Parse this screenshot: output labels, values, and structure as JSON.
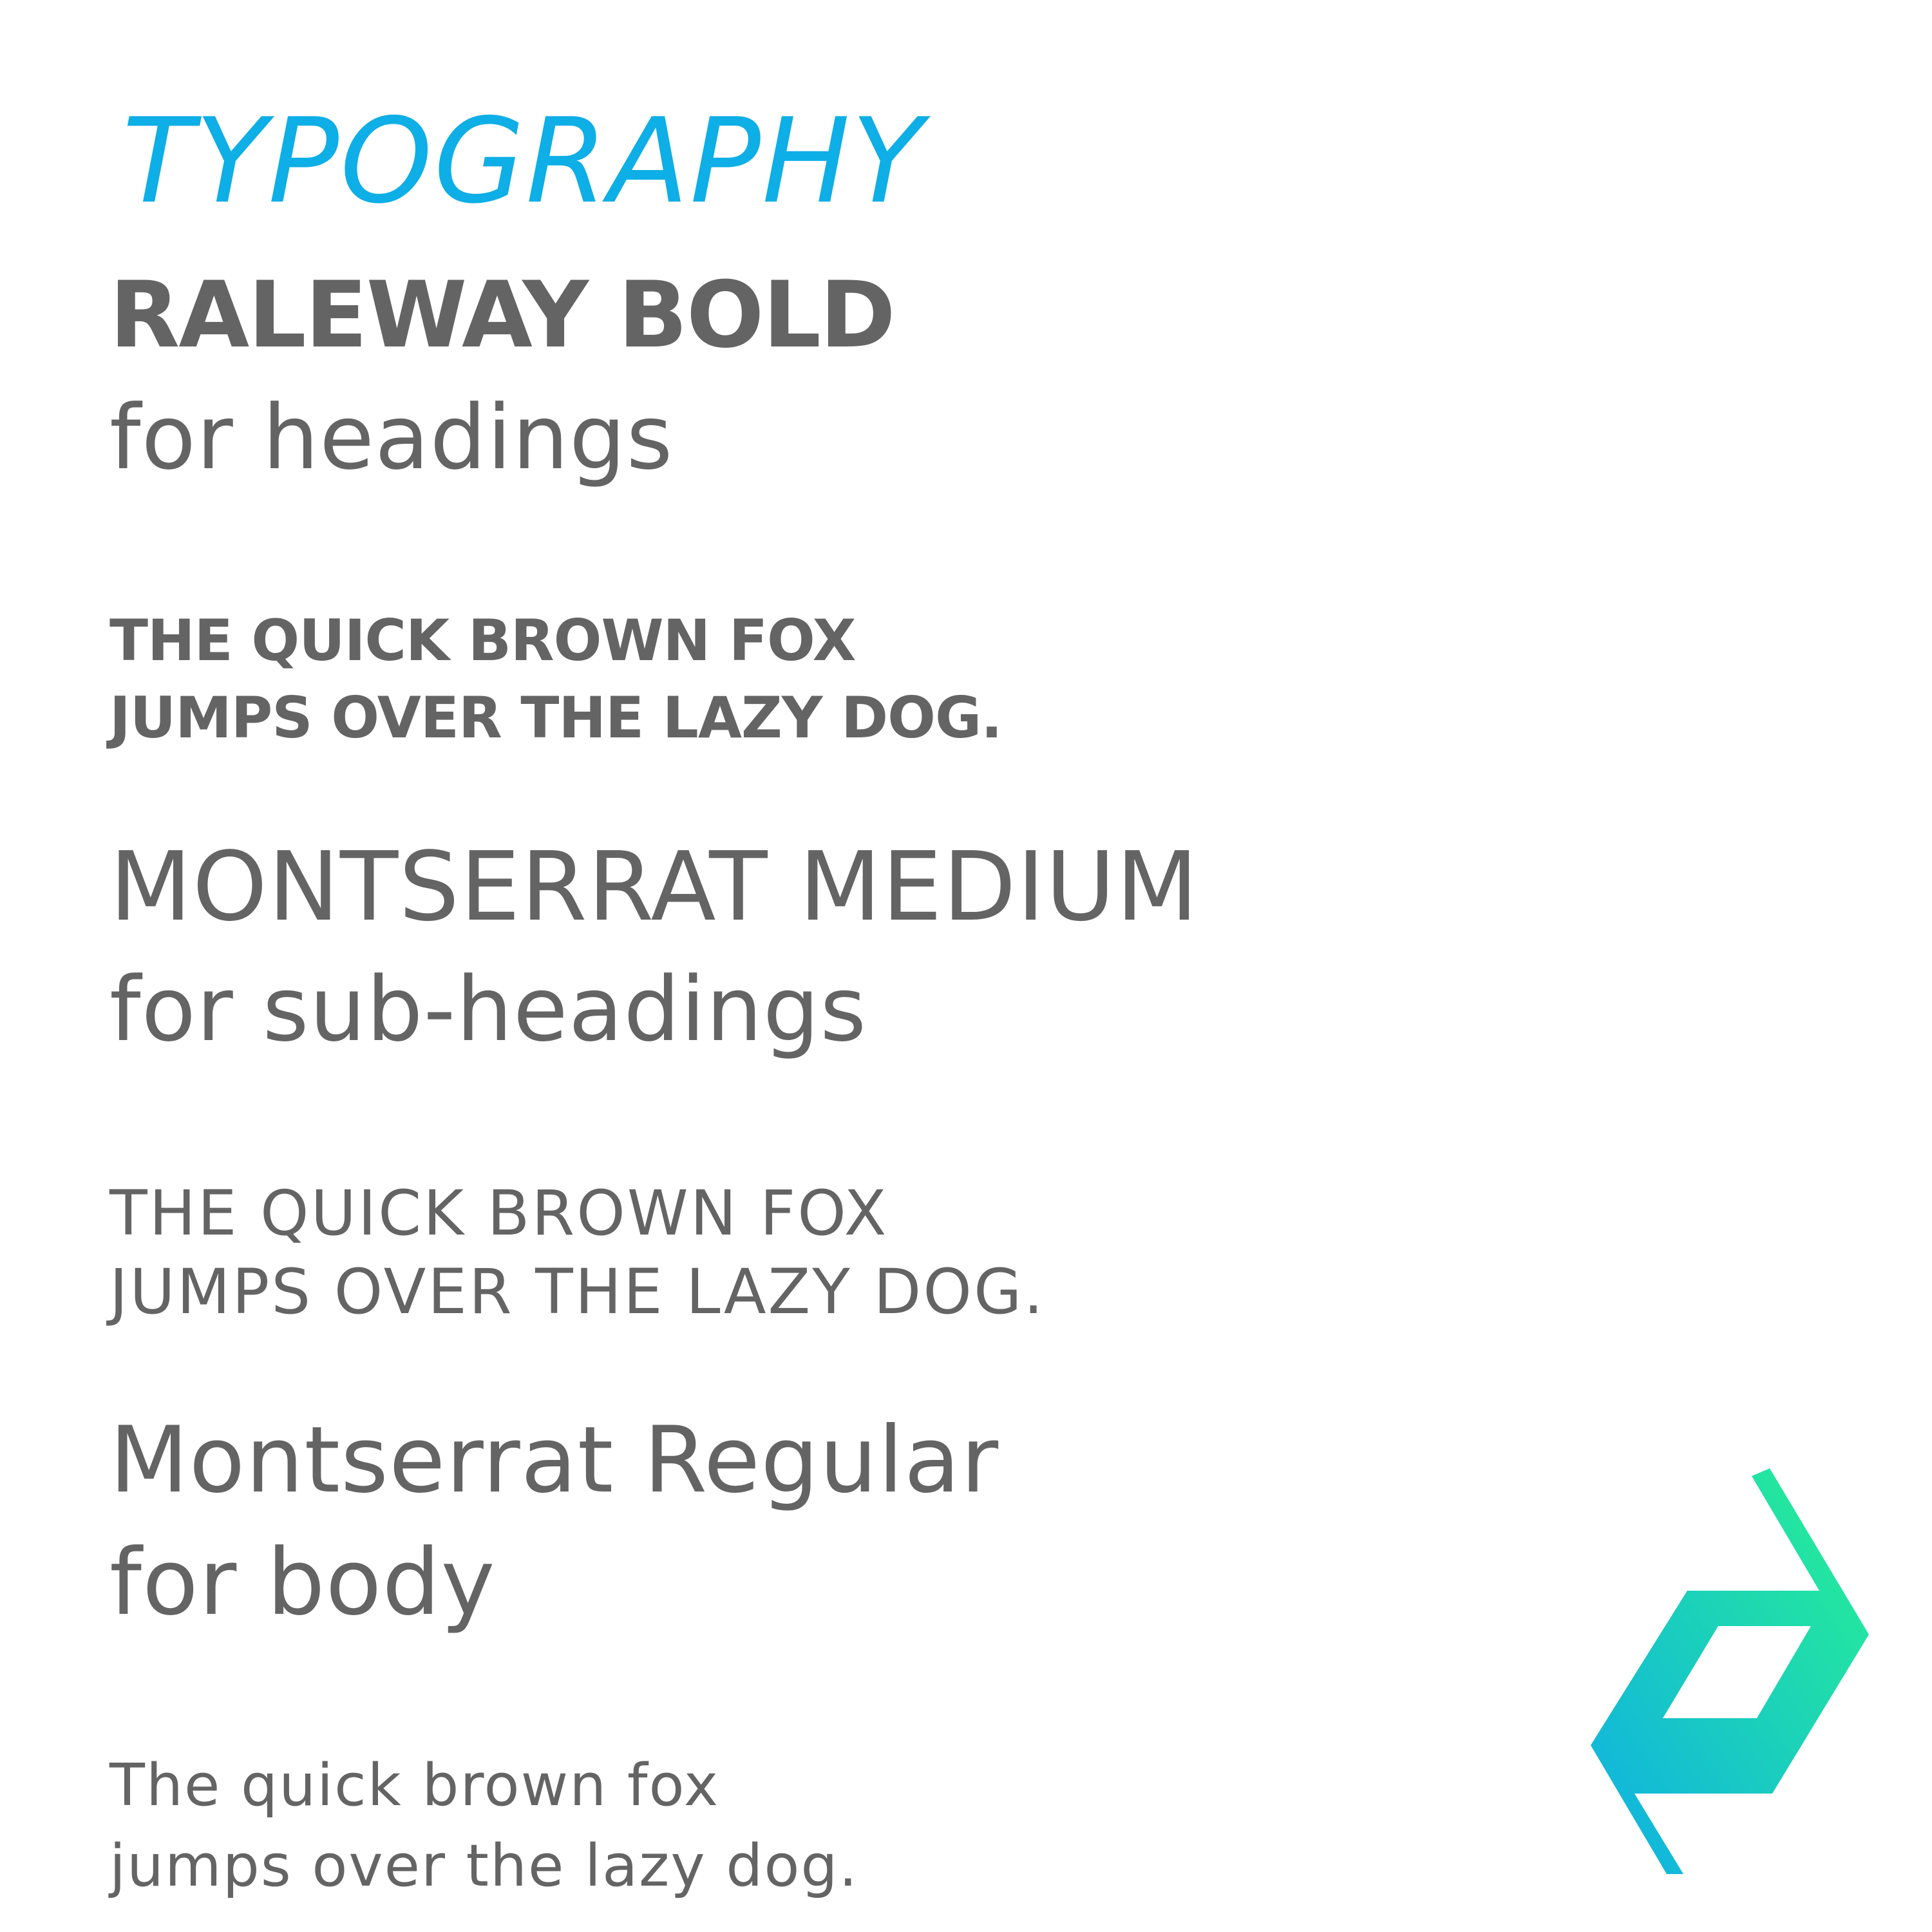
{
  "title": "TYPOGRAPHY",
  "heading_section": {
    "font_name": "RALEWAY BOLD",
    "usage": "for headings",
    "sample_lines": [
      "THE QUICK BROWN FOX",
      "JUMPS OVER THE LAZY DOG."
    ]
  },
  "subheading_section": {
    "font_name": "MONTSERRAT MEDIUM",
    "usage": "for sub-headings",
    "sample_lines": [
      "THE QUICK BROWN FOX",
      "JUMPS OVER THE LAZY DOG."
    ]
  },
  "body_section": {
    "font_name": "Montserrat Regular",
    "usage": "for body",
    "sample_lines": [
      "The quick brown fox",
      "jumps over the lazy dog."
    ]
  },
  "logo": {
    "icon": "brand-logo-icon",
    "gradient_start": "#0eaee6",
    "gradient_end": "#28f290"
  },
  "colors": {
    "accent": "#0eaee6",
    "text": "#646464",
    "background": "#ffffff"
  }
}
